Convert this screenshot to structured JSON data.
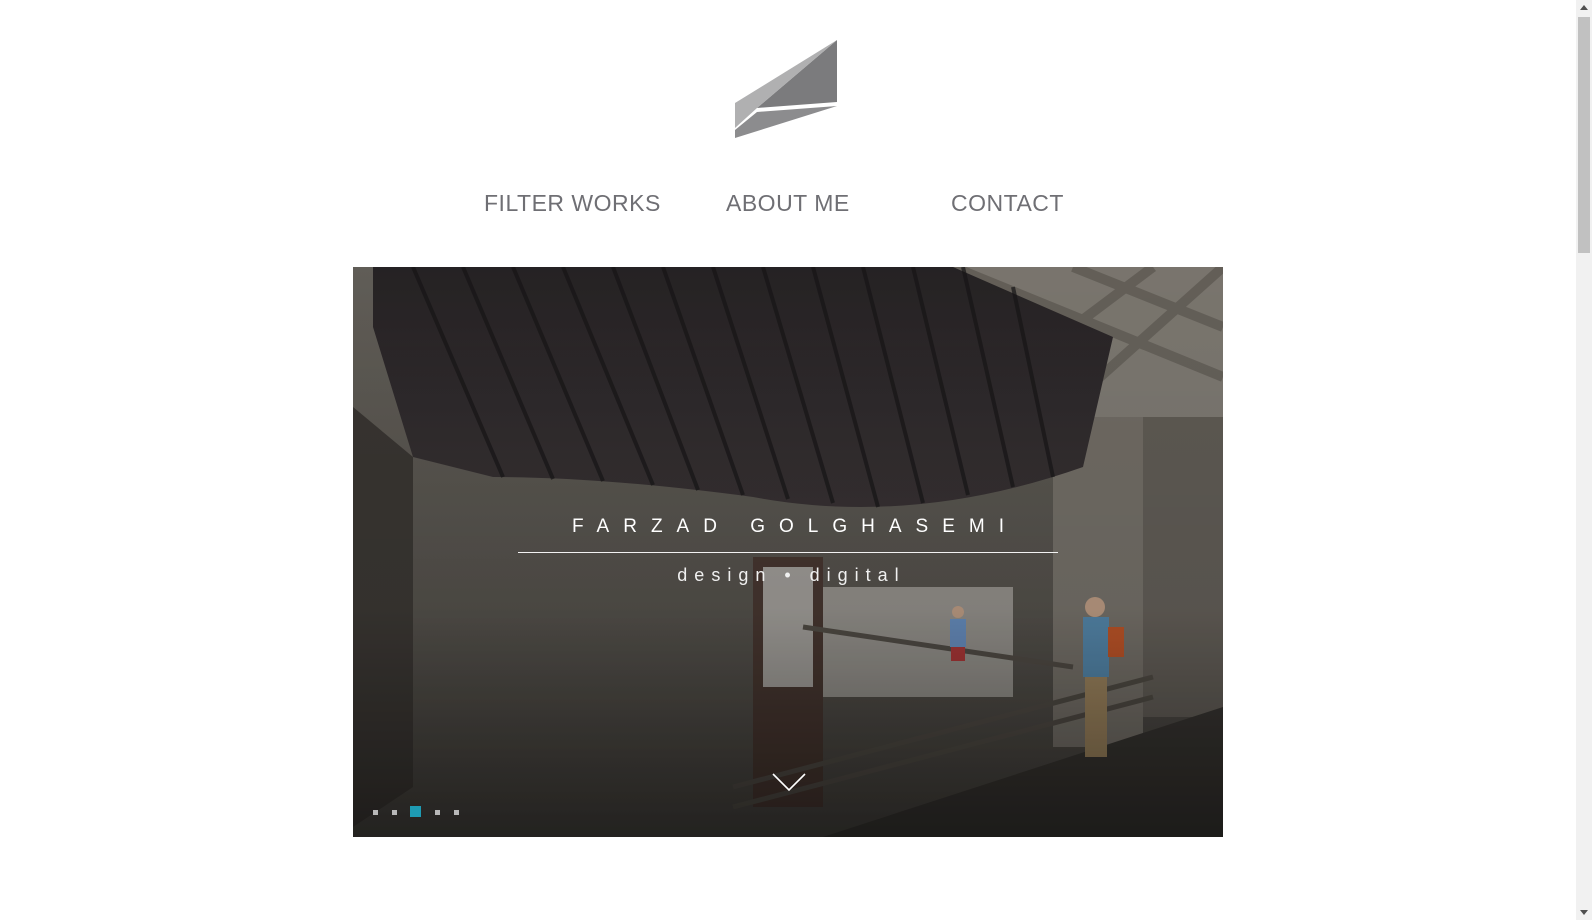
{
  "nav": {
    "filter_works": "FILTER WORKS",
    "about_me": "ABOUT ME",
    "contact": "CONTACT"
  },
  "hero": {
    "title": "FARZAD GOLGHASEMI",
    "subtitle": "design • digital",
    "slides_count": 5,
    "active_slide": 3
  },
  "icons": {
    "logo": "triangle-logo-icon",
    "scroll_down": "chevron-down-icon"
  },
  "colors": {
    "nav_text": "#6f6f74",
    "accent": "#1e9bb3",
    "logo_dark": "#7d7d7f",
    "logo_light": "#a9a9aa"
  }
}
